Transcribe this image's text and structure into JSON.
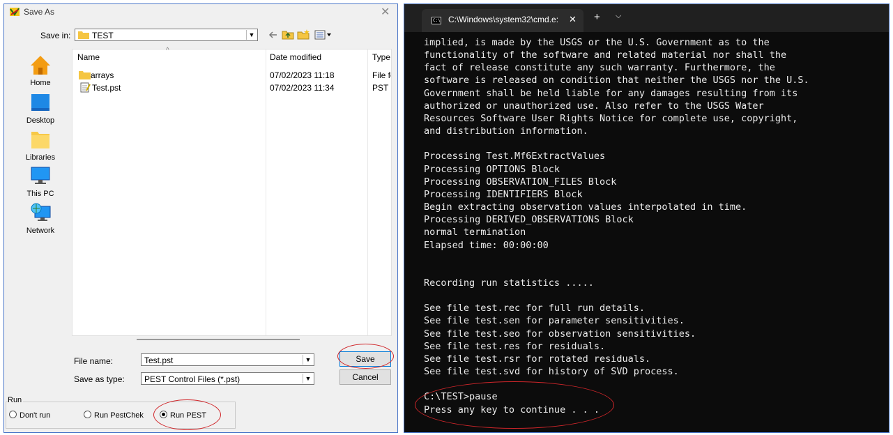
{
  "dialog": {
    "title": "Save As",
    "close_glyph": "✕",
    "save_in_label": "Save in:",
    "save_in_value": "TEST",
    "places": [
      {
        "label": "Home",
        "icon": "home-icon"
      },
      {
        "label": "Desktop",
        "icon": "desktop-icon"
      },
      {
        "label": "Libraries",
        "icon": "libraries-icon"
      },
      {
        "label": "This PC",
        "icon": "this-pc-icon"
      },
      {
        "label": "Network",
        "icon": "network-icon"
      }
    ],
    "columns": {
      "name": "Name",
      "date": "Date modified",
      "type": "Type"
    },
    "files": [
      {
        "name": "arrays",
        "date": "07/02/2023 11:18",
        "type": "File fo",
        "icon": "folder-icon"
      },
      {
        "name": "Test.pst",
        "date": "07/02/2023 11:34",
        "type": "PST F",
        "icon": "pst-file-icon"
      }
    ],
    "file_name_label": "File name:",
    "file_name_value": "Test.pst",
    "save_as_type_label": "Save as type:",
    "save_as_type_value": "PEST Control Files (*.pst)",
    "save_button": "Save",
    "cancel_button": "Cancel",
    "run_group_label": "Run",
    "run_options": [
      {
        "label": "Don't run",
        "selected": false
      },
      {
        "label": "Run PestChek",
        "selected": false
      },
      {
        "label": "Run PEST",
        "selected": true
      }
    ]
  },
  "console": {
    "tab_title": "C:\\Windows\\system32\\cmd.e:",
    "tab_close": "✕",
    "new_tab": "+",
    "dropdown": "⌵",
    "lines": [
      "implied, is made by the USGS or the U.S. Government as to the",
      "functionality of the software and related material nor shall the",
      "fact of release constitute any such warranty. Furthermore, the",
      "software is released on condition that neither the USGS nor the U.S.",
      "Government shall be held liable for any damages resulting from its",
      "authorized or unauthorized use. Also refer to the USGS Water",
      "Resources Software User Rights Notice for complete use, copyright,",
      "and distribution information.",
      "",
      "Processing Test.Mf6ExtractValues",
      "Processing OPTIONS Block",
      "Processing OBSERVATION_FILES Block",
      "Processing IDENTIFIERS Block",
      "Begin extracting observation values interpolated in time.",
      "Processing DERIVED_OBSERVATIONS Block",
      "normal termination",
      "Elapsed time: 00:00:00",
      "",
      "",
      "Recording run statistics .....",
      "",
      "See file test.rec for full run details.",
      "See file test.sen for parameter sensitivities.",
      "See file test.seo for observation sensitivities.",
      "See file test.res for residuals.",
      "See file test.rsr for rotated residuals.",
      "See file test.svd for history of SVD process.",
      "",
      "C:\\TEST>pause",
      "Press any key to continue . . ."
    ]
  },
  "colors": {
    "annotation": "#d0262a",
    "console_bg": "#0c0c0c",
    "dialog_bg": "#f0f0f0"
  }
}
